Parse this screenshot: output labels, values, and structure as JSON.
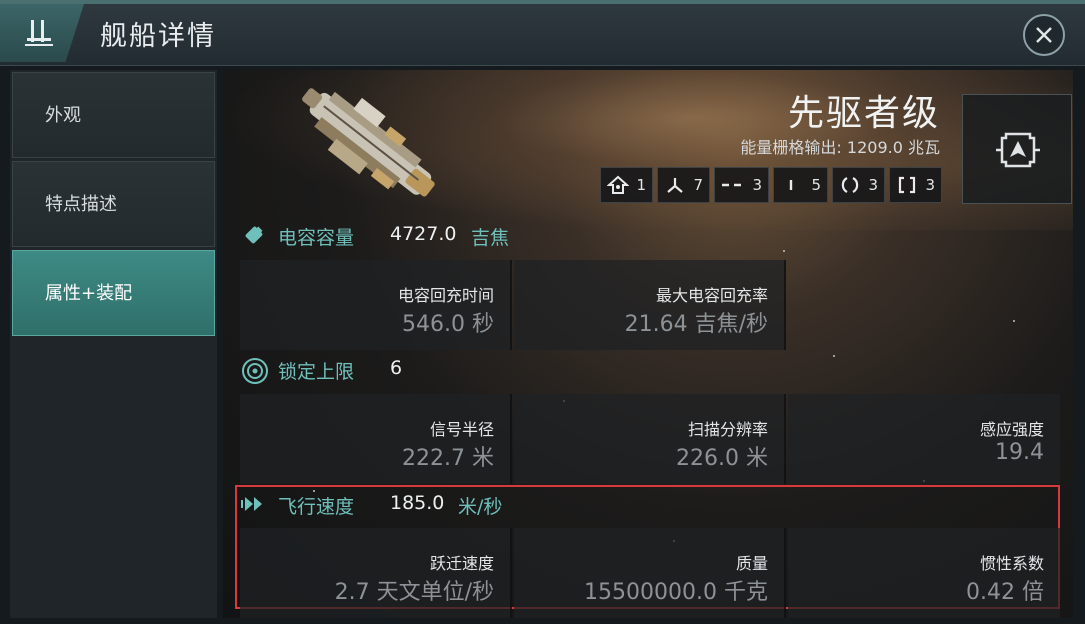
{
  "window": {
    "title": "舰船详情"
  },
  "sidebar": {
    "items": [
      {
        "label": "外观"
      },
      {
        "label": "特点描述"
      },
      {
        "label": "属性+装配"
      }
    ]
  },
  "ship": {
    "name": "先驱者级",
    "power_grid_label": "能量栅格输出:",
    "power_grid_value": "1209.0 兆瓦"
  },
  "slots": [
    {
      "icon": "turret-hardpoint-icon",
      "count": "1"
    },
    {
      "icon": "launcher-hardpoint-icon",
      "count": "7"
    },
    {
      "icon": "high-slot-icon",
      "count": "3"
    },
    {
      "icon": "mid-slot-icon",
      "count": "5"
    },
    {
      "icon": "low-slot-icon",
      "count": "3"
    },
    {
      "icon": "rig-slot-icon",
      "count": "3"
    }
  ],
  "capacitor": {
    "label": "电容容量",
    "value": "4727.0",
    "unit": "吉焦",
    "stats": [
      {
        "label": "电容回充时间",
        "value": "546.0 秒"
      },
      {
        "label": "最大电容回充率",
        "value": "21.64 吉焦/秒"
      }
    ]
  },
  "targeting": {
    "label": "锁定上限",
    "value": "6",
    "stats": [
      {
        "label": "信号半径",
        "value": "222.7 米"
      },
      {
        "label": "扫描分辨率",
        "value": "226.0 米"
      },
      {
        "label": "感应强度",
        "value": "19.4"
      }
    ]
  },
  "speed": {
    "label": "飞行速度",
    "value": "185.0",
    "unit": "米/秒",
    "stats": [
      {
        "label": "跃迁速度",
        "value": "2.7 天文单位/秒"
      },
      {
        "label": "质量",
        "value": "15500000.0 千克"
      },
      {
        "label": "惯性系数",
        "value": "0.42 倍"
      }
    ]
  },
  "colors": {
    "accent": "#6fbfbb",
    "highlight_border": "#d63a3a",
    "active_tab": "#3e8a84"
  }
}
